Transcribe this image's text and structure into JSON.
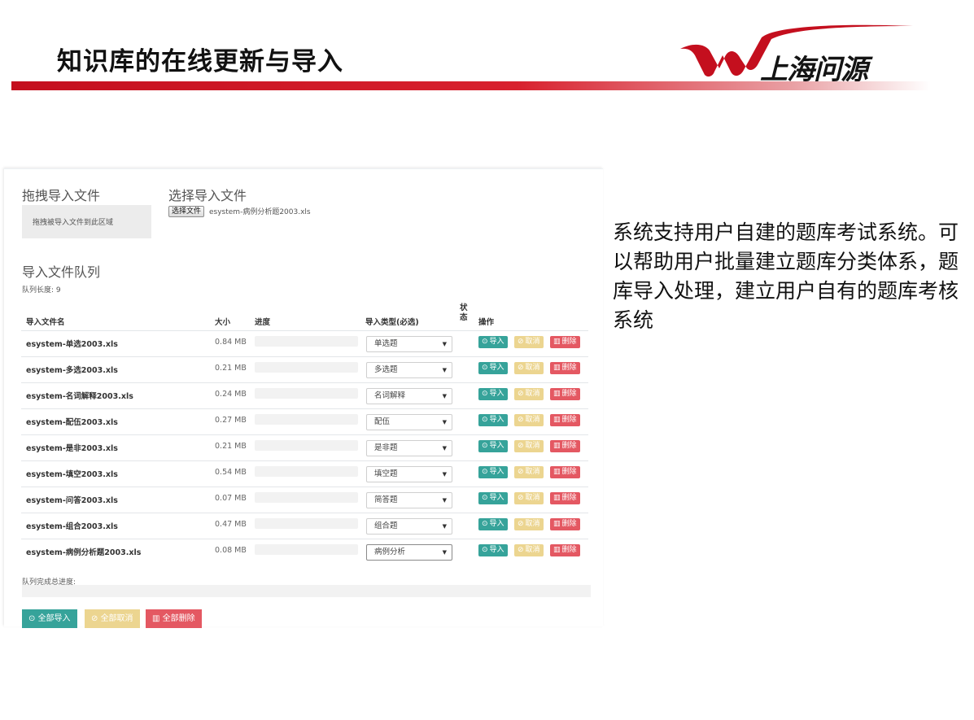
{
  "slide": {
    "title": "知识库的在线更新与导入",
    "logo_text": "上海问源",
    "description": "系统支持用户自建的题库考试系统。可以帮助用户批量建立题库分类体系，题库导入处理，建立用户自有的题库考核系统"
  },
  "colors": {
    "brand_red": "#c40f1e",
    "import_teal": "#36a39a",
    "cancel_yellow": "#ecd590",
    "delete_red": "#e45862"
  },
  "drag_section": {
    "heading": "拖拽导入文件",
    "drop_zone_text": "拖拽被导入文件到此区域"
  },
  "select_section": {
    "heading": "选择导入文件",
    "file_button": "选择文件",
    "file_name": "esystem-病例分析题2003.xls"
  },
  "queue": {
    "heading": "导入文件队列",
    "length_text": "队列长度: 9",
    "columns": {
      "name": "导入文件名",
      "size": "大小",
      "progress": "进度",
      "type": "导入类型(必选)",
      "status": "状态",
      "actions": "操作"
    },
    "action_labels": {
      "import": "导入",
      "cancel": "取消",
      "delete": "删除"
    },
    "action_icons": {
      "import": "upload-circle-icon",
      "cancel": "ban-icon",
      "delete": "trash-icon"
    },
    "files": [
      {
        "name": "esystem-单选2003.xls",
        "size": "0.84 MB",
        "progress": 0,
        "type": "单选题"
      },
      {
        "name": "esystem-多选2003.xls",
        "size": "0.21 MB",
        "progress": 0,
        "type": "多选题"
      },
      {
        "name": "esystem-名词解释2003.xls",
        "size": "0.24 MB",
        "progress": 0,
        "type": "名词解释"
      },
      {
        "name": "esystem-配伍2003.xls",
        "size": "0.27 MB",
        "progress": 0,
        "type": "配伍"
      },
      {
        "name": "esystem-是非2003.xls",
        "size": "0.21 MB",
        "progress": 0,
        "type": "是非题"
      },
      {
        "name": "esystem-填空2003.xls",
        "size": "0.54 MB",
        "progress": 0,
        "type": "填空题"
      },
      {
        "name": "esystem-问答2003.xls",
        "size": "0.07 MB",
        "progress": 0,
        "type": "简答题"
      },
      {
        "name": "esystem-组合2003.xls",
        "size": "0.47 MB",
        "progress": 0,
        "type": "组合题"
      },
      {
        "name": "esystem-病例分析题2003.xls",
        "size": "0.08 MB",
        "progress": 0,
        "type": "病例分析"
      }
    ],
    "total_progress_label": "队列完成总进度:",
    "total_progress": 0
  },
  "bulk_actions": {
    "import_all": "全部导入",
    "cancel_all": "全部取消",
    "delete_all": "全部删除"
  }
}
